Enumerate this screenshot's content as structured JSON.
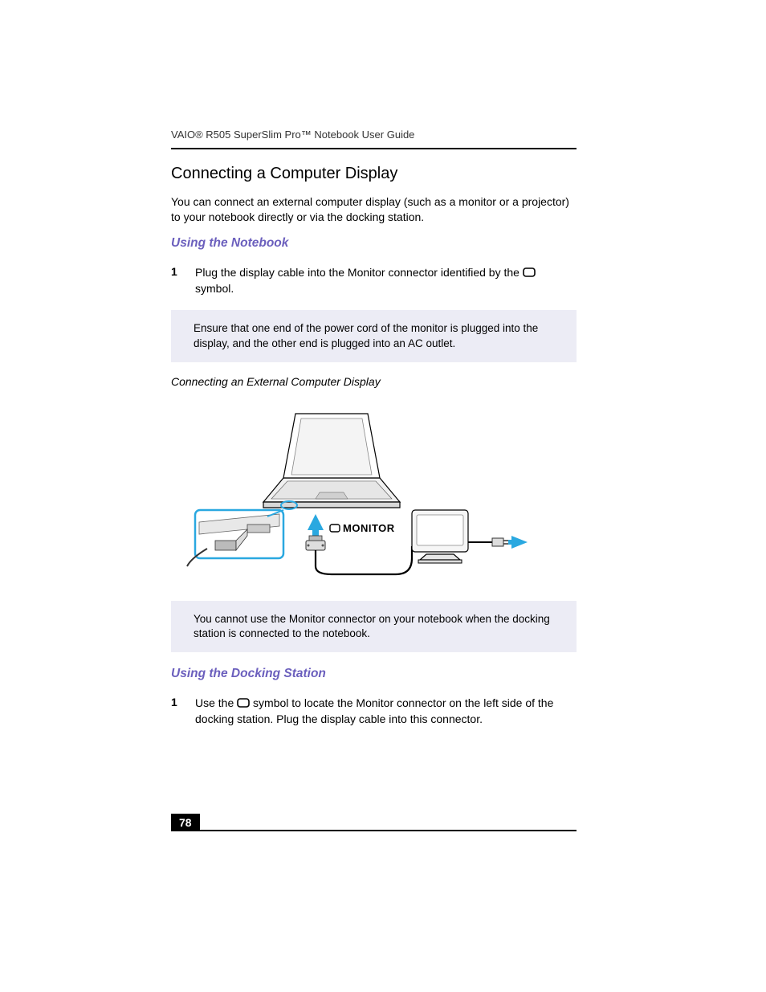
{
  "running_head": "VAIO® R505 SuperSlim Pro™ Notebook User Guide",
  "sections": {
    "main_title": "Connecting a Computer Display",
    "intro": "You can connect an external computer display (such as a monitor or a projector) to your notebook directly or via the docking station.",
    "notebook": {
      "heading": "Using the Notebook",
      "step1_num": "1",
      "step1_text_pre": "Plug the display cable into the Monitor connector identified by the ",
      "step1_text_post": " symbol.",
      "note": "Ensure that one end of the power cord of the monitor is plugged into the display, and the other end is plugged into an AC outlet.",
      "fig_caption": "Connecting an External Computer Display",
      "monitor_label": "MONITOR",
      "note2": "You cannot use the Monitor connector on your notebook when the docking station is connected to the notebook."
    },
    "docking": {
      "heading": "Using the Docking Station",
      "step1_num": "1",
      "step1_text_pre": "Use the ",
      "step1_text_post": " symbol to locate the Monitor connector on the left side of the docking station. Plug the display cable into this connector."
    }
  },
  "page_number": "78"
}
